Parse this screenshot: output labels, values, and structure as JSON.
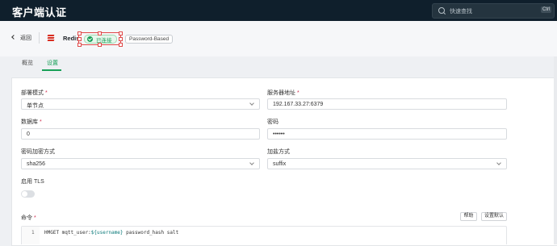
{
  "app": {
    "title": "客户端认证"
  },
  "search": {
    "placeholder": "快速查找",
    "shortcut": "Ctrl"
  },
  "header": {
    "back_label": "返回",
    "name": "Redis",
    "status": "已连接",
    "auth_badge": "Password-Based"
  },
  "tabs": [
    {
      "label": "概览",
      "active": false
    },
    {
      "label": "设置",
      "active": true
    }
  ],
  "form": {
    "deploy_mode": {
      "label": "部署模式",
      "value": "单节点"
    },
    "server": {
      "label": "服务器地址",
      "value": "192.167.33.27:6379"
    },
    "database": {
      "label": "数据库",
      "value": "0"
    },
    "password": {
      "label": "密码",
      "value": "••••••"
    },
    "hash_method": {
      "label": "密码加密方式",
      "value": "sha256"
    },
    "salt_method": {
      "label": "加盐方式",
      "value": "suffix"
    },
    "tls": {
      "label": "启用 TLS",
      "enabled": false
    },
    "command": {
      "label": "命令",
      "help_button": "帮助",
      "default_button": "设置默认",
      "line_number": "1",
      "code_prefix": "HMGET mqtt_user:",
      "code_var": "${username}",
      "code_suffix": " password_hash salt"
    }
  },
  "colors": {
    "accent": "#18a058",
    "topbar": "#0f1f2c",
    "required": "#d03050",
    "redis": "#d82c20"
  },
  "icons": {
    "search": "search-icon",
    "back": "chevron-left-icon",
    "status": "check-circle-icon",
    "db": "redis-icon"
  }
}
